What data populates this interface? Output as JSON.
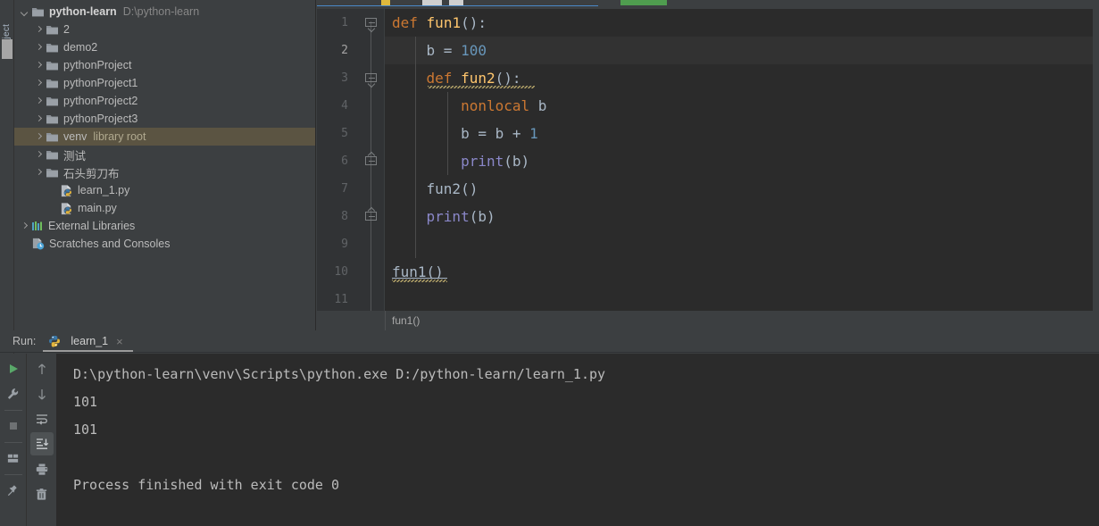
{
  "tool_strip": {
    "vertical_label": "Project"
  },
  "project": {
    "tree": [
      {
        "depth": 0,
        "arrow": "down",
        "icon": "folder-icon",
        "label": "python-learn",
        "sub": "D:\\python-learn",
        "bold": true,
        "selected": false
      },
      {
        "depth": 1,
        "arrow": "right",
        "icon": "folder-icon",
        "label": "2",
        "sub": "",
        "bold": false,
        "selected": false
      },
      {
        "depth": 1,
        "arrow": "right",
        "icon": "folder-icon",
        "label": "demo2",
        "sub": "",
        "bold": false,
        "selected": false
      },
      {
        "depth": 1,
        "arrow": "right",
        "icon": "folder-icon",
        "label": "pythonProject",
        "sub": "",
        "bold": false,
        "selected": false
      },
      {
        "depth": 1,
        "arrow": "right",
        "icon": "folder-icon",
        "label": "pythonProject1",
        "sub": "",
        "bold": false,
        "selected": false
      },
      {
        "depth": 1,
        "arrow": "right",
        "icon": "folder-icon",
        "label": "pythonProject2",
        "sub": "",
        "bold": false,
        "selected": false
      },
      {
        "depth": 1,
        "arrow": "right",
        "icon": "folder-icon",
        "label": "pythonProject3",
        "sub": "",
        "bold": false,
        "selected": false
      },
      {
        "depth": 1,
        "arrow": "right",
        "icon": "folder-icon",
        "label": "venv",
        "sub": "library root",
        "bold": false,
        "selected": true
      },
      {
        "depth": 1,
        "arrow": "right",
        "icon": "folder-icon",
        "label": "测试",
        "sub": "",
        "bold": false,
        "selected": false
      },
      {
        "depth": 1,
        "arrow": "right",
        "icon": "folder-icon",
        "label": "石头剪刀布",
        "sub": "",
        "bold": false,
        "selected": false
      },
      {
        "depth": 2,
        "arrow": "none",
        "icon": "python-file-icon",
        "label": "learn_1.py",
        "sub": "",
        "bold": false,
        "selected": false
      },
      {
        "depth": 2,
        "arrow": "none",
        "icon": "python-file-icon",
        "label": "main.py",
        "sub": "",
        "bold": false,
        "selected": false
      },
      {
        "depth": 0,
        "arrow": "right",
        "icon": "libraries-icon",
        "label": "External Libraries",
        "sub": "",
        "bold": false,
        "selected": false
      },
      {
        "depth": 0,
        "arrow": "none",
        "icon": "scratches-icon",
        "label": "Scratches and Consoles",
        "sub": "",
        "bold": false,
        "selected": false
      }
    ]
  },
  "editor": {
    "lines": [
      {
        "num": "1",
        "tokens": [
          {
            "t": "def",
            "c": "kw"
          },
          {
            "t": " ",
            "c": "pn"
          },
          {
            "t": "fun1",
            "c": "fn"
          },
          {
            "t": "():",
            "c": "pn"
          }
        ]
      },
      {
        "num": "2",
        "tokens": [
          {
            "t": "    ",
            "c": "pn"
          },
          {
            "t": "b",
            "c": "id"
          },
          {
            "t": " = ",
            "c": "pn"
          },
          {
            "t": "100",
            "c": "num"
          }
        ]
      },
      {
        "num": "3",
        "tokens": [
          {
            "t": "    ",
            "c": "pn"
          },
          {
            "t": "def",
            "c": "kw"
          },
          {
            "t": " ",
            "c": "pn"
          },
          {
            "t": "fun2",
            "c": "fn"
          },
          {
            "t": "():",
            "c": "pn"
          }
        ]
      },
      {
        "num": "4",
        "tokens": [
          {
            "t": "        ",
            "c": "pn"
          },
          {
            "t": "nonlocal",
            "c": "kw"
          },
          {
            "t": " ",
            "c": "pn"
          },
          {
            "t": "b",
            "c": "id"
          }
        ]
      },
      {
        "num": "5",
        "tokens": [
          {
            "t": "        ",
            "c": "pn"
          },
          {
            "t": "b",
            "c": "id"
          },
          {
            "t": " = ",
            "c": "pn"
          },
          {
            "t": "b",
            "c": "id"
          },
          {
            "t": " + ",
            "c": "pn"
          },
          {
            "t": "1",
            "c": "num"
          }
        ]
      },
      {
        "num": "6",
        "tokens": [
          {
            "t": "        ",
            "c": "pn"
          },
          {
            "t": "print",
            "c": "pur"
          },
          {
            "t": "(",
            "c": "pn"
          },
          {
            "t": "b",
            "c": "id"
          },
          {
            "t": ")",
            "c": "pn"
          }
        ]
      },
      {
        "num": "7",
        "tokens": [
          {
            "t": "    ",
            "c": "pn"
          },
          {
            "t": "fun2",
            "c": "id"
          },
          {
            "t": "()",
            "c": "pn"
          }
        ]
      },
      {
        "num": "8",
        "tokens": [
          {
            "t": "    ",
            "c": "pn"
          },
          {
            "t": "print",
            "c": "pur"
          },
          {
            "t": "(",
            "c": "pn"
          },
          {
            "t": "b",
            "c": "id"
          },
          {
            "t": ")",
            "c": "pn"
          }
        ]
      },
      {
        "num": "9",
        "tokens": []
      },
      {
        "num": "10",
        "tokens": [
          {
            "t": "fun1",
            "c": "id"
          },
          {
            "t": "()",
            "c": "pn"
          }
        ]
      },
      {
        "num": "11",
        "tokens": []
      }
    ],
    "caret_line": 2,
    "breadcrumb": "fun1()",
    "colors": {
      "keyword": "#cc7832",
      "function_def": "#ffc66d",
      "builtin": "#8a87c8",
      "number": "#6897bb",
      "identifier": "#a9b7c6",
      "editor_bg": "#2b2b2b",
      "gutter_bg": "#313335",
      "caret_line_bg": "#323232",
      "tab_active_underline": "#4a88c7"
    }
  },
  "run_panel": {
    "title": "Run:",
    "tab": {
      "label": "learn_1",
      "icon": "python-icon",
      "close": "×"
    },
    "toolbar_left": [
      {
        "name": "rerun-button",
        "icon": "play-icon"
      },
      {
        "name": "settings-button",
        "icon": "wrench-icon"
      },
      {
        "name": "stop-button",
        "icon": "stop-icon"
      },
      {
        "name": "layout-button",
        "icon": "layout-icon"
      },
      {
        "name": "pin-tab-button",
        "icon": "pin-icon"
      }
    ],
    "toolbar_right": [
      {
        "name": "up-stacktrace-button",
        "icon": "arrow-up-icon"
      },
      {
        "name": "down-stacktrace-button",
        "icon": "arrow-down-icon"
      },
      {
        "name": "soft-wrap-button",
        "icon": "soft-wrap-icon"
      },
      {
        "name": "scroll-to-end-button",
        "icon": "scroll-end-icon",
        "active": true
      },
      {
        "name": "print-button",
        "icon": "printer-icon"
      },
      {
        "name": "clear-all-button",
        "icon": "trash-icon"
      }
    ],
    "console_lines": [
      "D:\\python-learn\\venv\\Scripts\\python.exe D:/python-learn/learn_1.py",
      "101",
      "101",
      "",
      "Process finished with exit code 0"
    ]
  }
}
